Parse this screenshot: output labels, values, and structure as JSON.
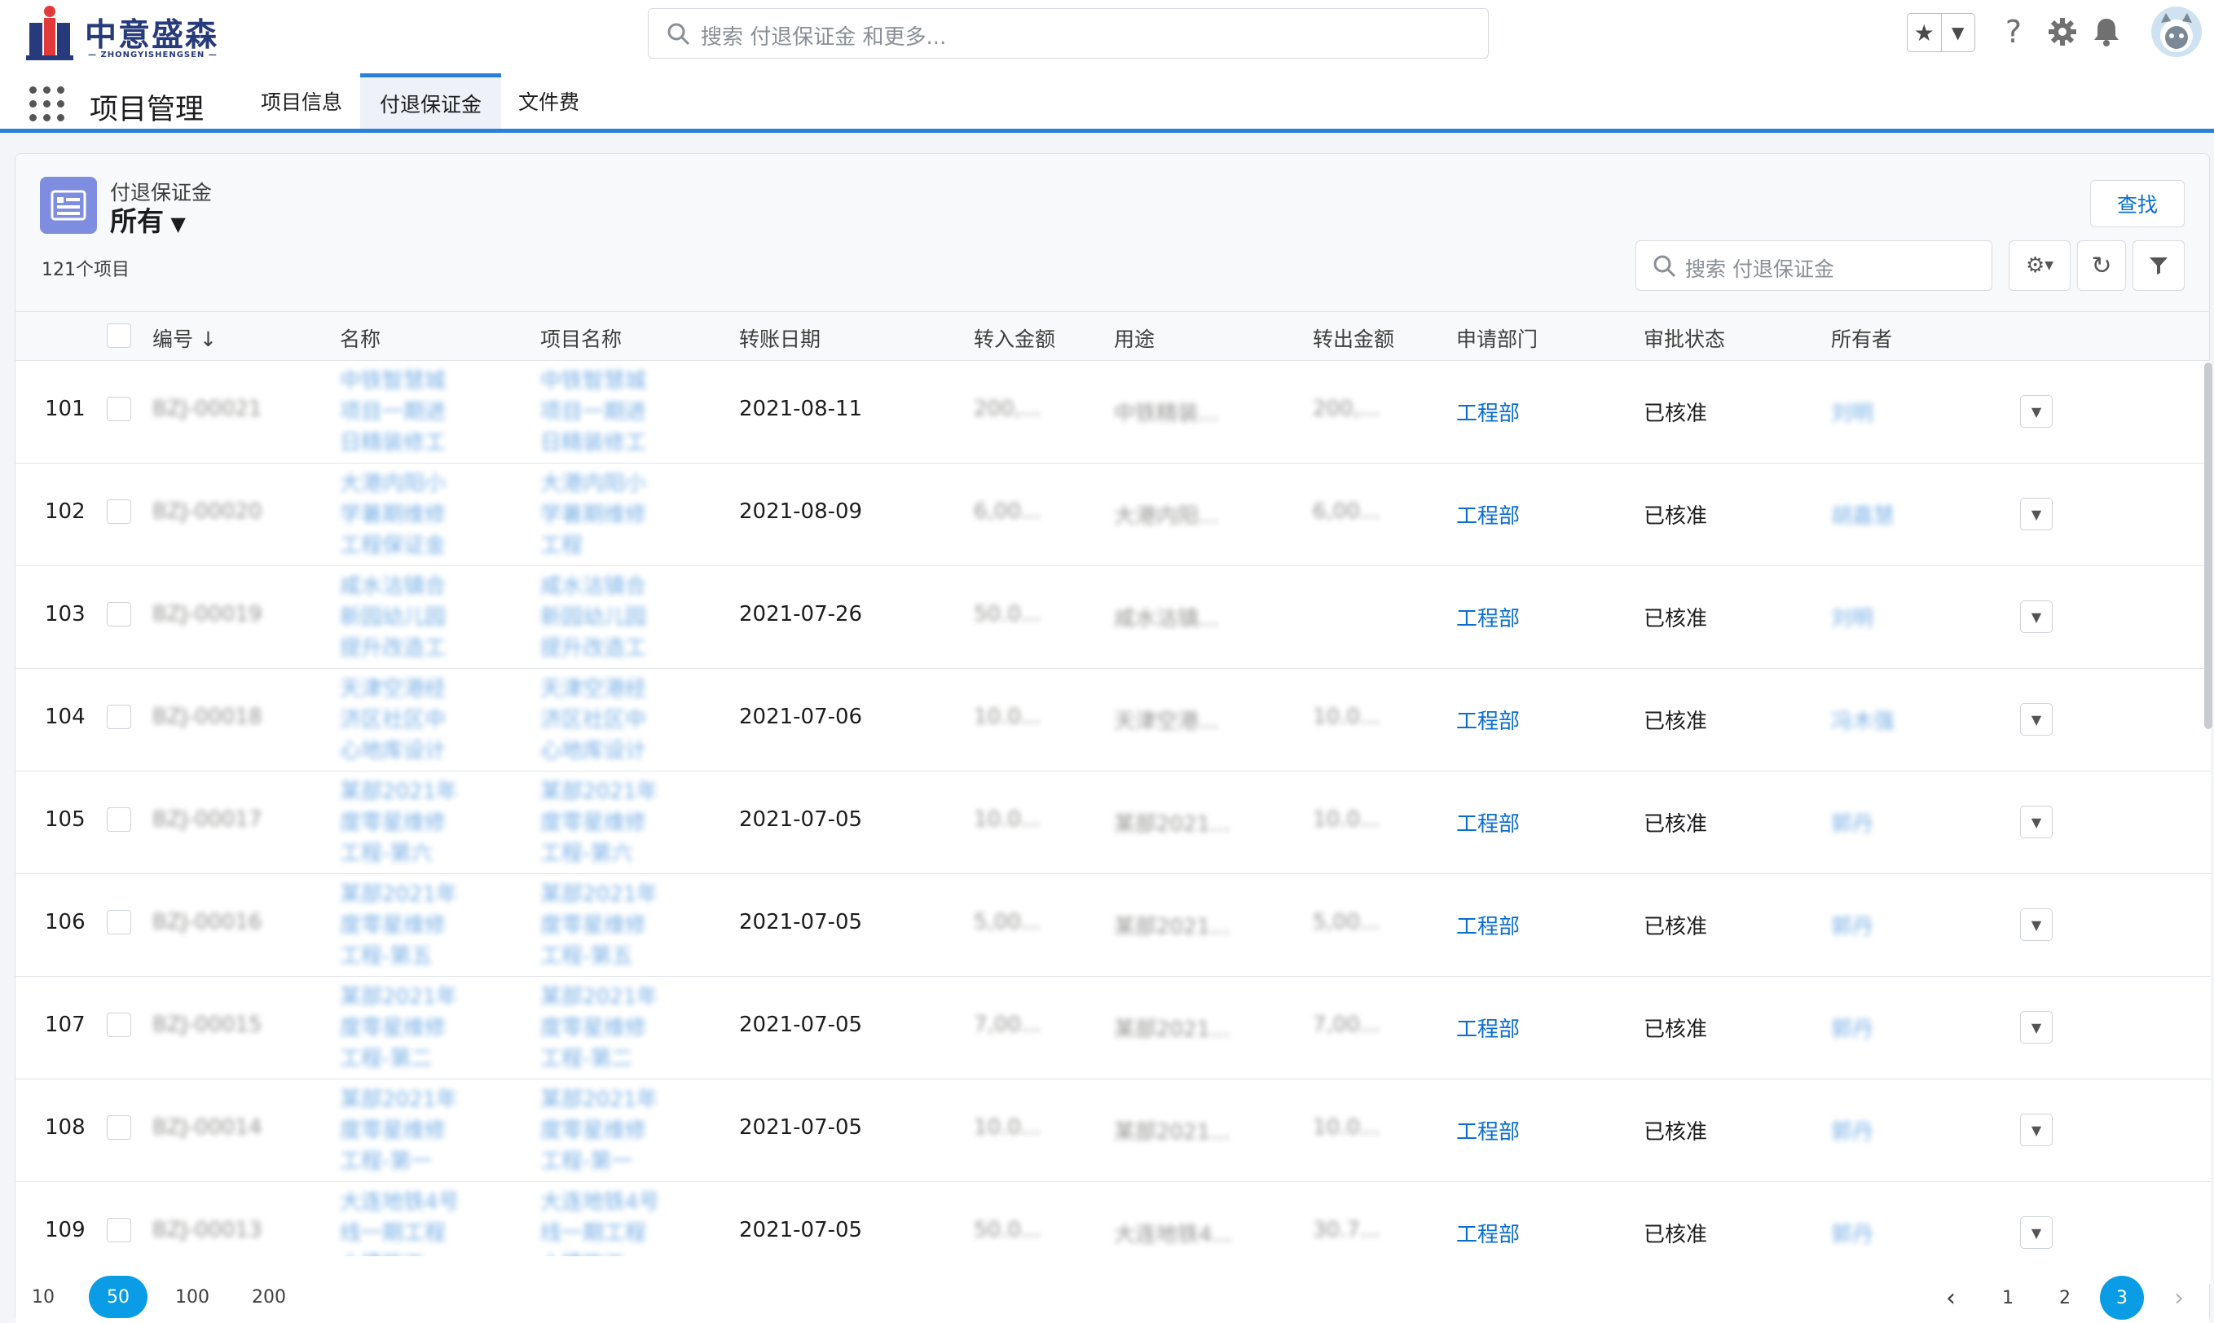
{
  "brand": {
    "name_cn": "中意盛森",
    "name_en": "— ZHONGYISHENGSEN —"
  },
  "header": {
    "search_placeholder": "搜索 付退保证金 和更多...",
    "icons": [
      "star-icon",
      "chevron-down-icon",
      "help-icon",
      "gear-icon",
      "bell-icon",
      "avatar"
    ]
  },
  "app": {
    "name": "项目管理"
  },
  "tabs": [
    {
      "label": "项目信息",
      "active": false
    },
    {
      "label": "付退保证金",
      "active": true
    },
    {
      "label": "文件费",
      "active": false
    }
  ],
  "list": {
    "object_label": "付退保证金",
    "view_name": "所有",
    "count_text": "121个项目",
    "find_button": "查找",
    "search_placeholder": "搜索 付退保证金"
  },
  "columns": [
    "编号",
    "名称",
    "项目名称",
    "转账日期",
    "转入金额",
    "用途",
    "转出金额",
    "申请部门",
    "审批状态",
    "所有者"
  ],
  "rows": [
    {
      "n": "101",
      "code": "BZJ-00021",
      "name": [
        "中铁智慧城",
        "项目一期进",
        "日精装修工"
      ],
      "project": [
        "中铁智慧城",
        "项目一期进",
        "日精装修工"
      ],
      "date": "2021-08-11",
      "in_amt": "200,...",
      "use": "中铁精装...",
      "out_amt": "200,...",
      "dept": "工程部",
      "status": "已核准",
      "owner": "刘明"
    },
    {
      "n": "102",
      "code": "BZJ-00020",
      "name": [
        "大港内阳小",
        "学暑期维修",
        "工程保证金"
      ],
      "project": [
        "大港内阳小",
        "学暑期维修",
        "工程"
      ],
      "date": "2021-08-09",
      "in_amt": "6,00...",
      "use": "大港内阳...",
      "out_amt": "6,00...",
      "dept": "工程部",
      "status": "已核准",
      "owner": "胡嘉慧"
    },
    {
      "n": "103",
      "code": "BZJ-00019",
      "name": [
        "咸水沽镇合",
        "新园幼儿园",
        "提升改造工"
      ],
      "project": [
        "咸水沽镇合",
        "新园幼儿园",
        "提升改造工"
      ],
      "date": "2021-07-26",
      "in_amt": "50.0...",
      "use": "咸水沽镇...",
      "out_amt": "",
      "dept": "工程部",
      "status": "已核准",
      "owner": "刘明"
    },
    {
      "n": "104",
      "code": "BZJ-00018",
      "name": [
        "天津空港经",
        "济区社区中",
        "心地库设计"
      ],
      "project": [
        "天津空港经",
        "济区社区中",
        "心地库设计"
      ],
      "date": "2021-07-06",
      "in_amt": "10.0...",
      "use": "天津空港...",
      "out_amt": "10.0...",
      "dept": "工程部",
      "status": "已核准",
      "owner": "冯木强"
    },
    {
      "n": "105",
      "code": "BZJ-00017",
      "name": [
        "某部2021年",
        "度零星维修",
        "工程-第六"
      ],
      "project": [
        "某部2021年",
        "度零星维修",
        "工程-第六"
      ],
      "date": "2021-07-05",
      "in_amt": "10.0...",
      "use": "某部2021...",
      "out_amt": "10.0...",
      "dept": "工程部",
      "status": "已核准",
      "owner": "郭丹"
    },
    {
      "n": "106",
      "code": "BZJ-00016",
      "name": [
        "某部2021年",
        "度零星维修",
        "工程-第五"
      ],
      "project": [
        "某部2021年",
        "度零星维修",
        "工程-第五"
      ],
      "date": "2021-07-05",
      "in_amt": "5,00...",
      "use": "某部2021...",
      "out_amt": "5,00...",
      "dept": "工程部",
      "status": "已核准",
      "owner": "郭丹"
    },
    {
      "n": "107",
      "code": "BZJ-00015",
      "name": [
        "某部2021年",
        "度零星维修",
        "工程-第二"
      ],
      "project": [
        "某部2021年",
        "度零星维修",
        "工程-第二"
      ],
      "date": "2021-07-05",
      "in_amt": "7,00...",
      "use": "某部2021...",
      "out_amt": "7,00...",
      "dept": "工程部",
      "status": "已核准",
      "owner": "郭丹"
    },
    {
      "n": "108",
      "code": "BZJ-00014",
      "name": [
        "某部2021年",
        "度零星维修",
        "工程-第一"
      ],
      "project": [
        "某部2021年",
        "度零星维修",
        "工程-第一"
      ],
      "date": "2021-07-05",
      "in_amt": "10.0...",
      "use": "某部2021...",
      "out_amt": "10.0...",
      "dept": "工程部",
      "status": "已核准",
      "owner": "郭丹"
    },
    {
      "n": "109",
      "code": "BZJ-00013",
      "name": [
        "大连地铁4号",
        "线一期工程",
        "土建施工"
      ],
      "project": [
        "大连地铁4号",
        "线一期工程",
        "土建施工"
      ],
      "date": "2021-07-05",
      "in_amt": "50.0...",
      "use": "大连地铁4...",
      "out_amt": "30.7...",
      "dept": "工程部",
      "status": "已核准",
      "owner": "郭丹"
    }
  ],
  "page_sizes": [
    "10",
    "50",
    "100",
    "200"
  ],
  "active_page_size": "50",
  "pages": [
    "1",
    "2",
    "3"
  ],
  "current_page": "3",
  "colors": {
    "accent": "#2a7fd8",
    "link": "#0a6ed1",
    "active_pill": "#0a9ce5",
    "object_icon": "#7f8de1",
    "brand": "#273a7b"
  }
}
